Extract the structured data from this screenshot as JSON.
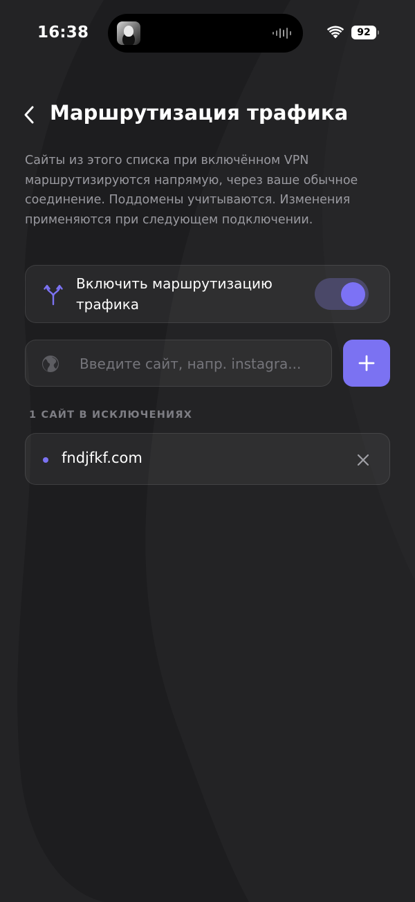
{
  "status_bar": {
    "time": "16:38",
    "battery": "92",
    "wifi_icon": "wifi-icon",
    "audio_icon": "waveform-icon"
  },
  "header": {
    "back_icon": "chevron-left-icon",
    "title": "Маршрутизация трафика"
  },
  "description": "Сайты из этого списка при включённом VPN маршрутизируются напрямую, через ваше обычное соединение. Поддомены учитываются. Изменения применяются при следующем подключении.",
  "routing_toggle": {
    "icon": "split-route-icon",
    "label": "Включить маршрутизацию трафика",
    "enabled": true
  },
  "add_site": {
    "icon": "globe-icon",
    "placeholder": "Введите сайт, напр. instagra...",
    "value": "",
    "add_icon": "plus-icon"
  },
  "exclusions": {
    "count_label": "1 САЙТ В ИСКЛЮЧЕНИЯХ",
    "items": [
      {
        "domain": "fndjfkf.com",
        "remove_icon": "close-icon"
      }
    ]
  },
  "colors": {
    "accent": "#7b72f2",
    "background": "#1d1d1f",
    "toggle_track": "#4a4868",
    "muted_text": "#9a9aa0"
  }
}
